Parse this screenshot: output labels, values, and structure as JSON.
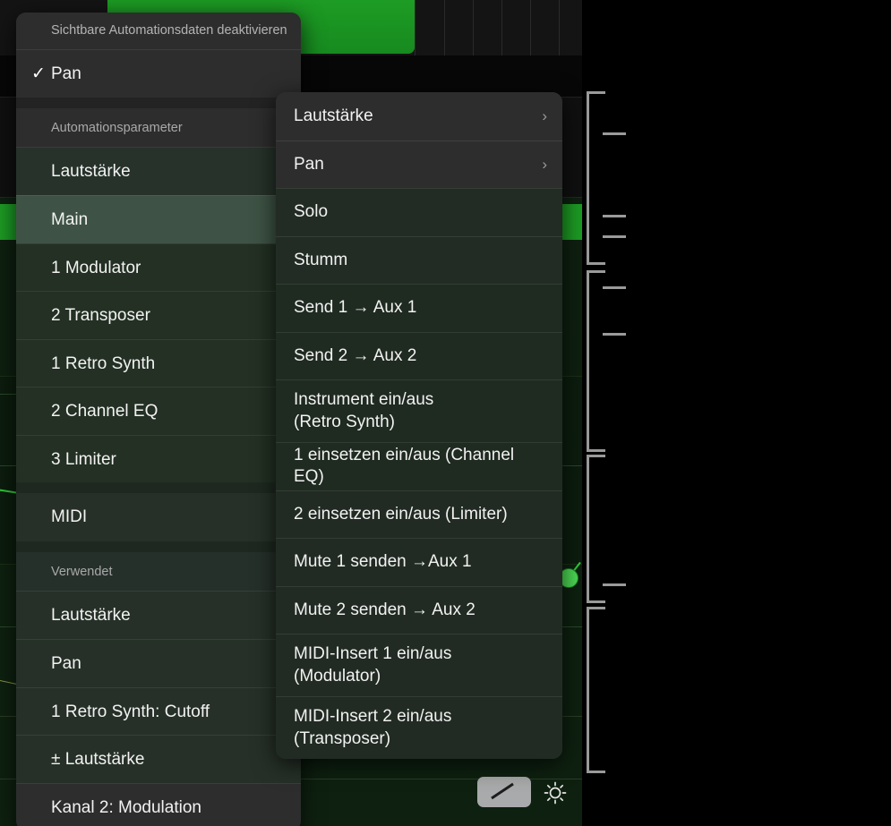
{
  "window": {
    "app_context": "Logic Pro Automationsparameter-Menü"
  },
  "background": {
    "tool_buttons": [
      {
        "name": "pencil-tool",
        "label": ""
      },
      {
        "name": "brightness-tool",
        "label": ""
      }
    ]
  },
  "menu_main": {
    "header_label": "Sichtbare Automationsdaten deaktivieren",
    "checked_item": {
      "label": "Pan",
      "check_glyph": "✓"
    },
    "section_automation_label": "Automationsparameter",
    "section_used_label": "Verwendet",
    "items_automation": [
      {
        "label": "Lautstärke",
        "selected": false
      },
      {
        "label": "Main",
        "selected": true
      },
      {
        "label": "1 Modulator",
        "selected": false
      },
      {
        "label": "2 Transposer",
        "selected": false
      },
      {
        "label": "1 Retro Synth",
        "selected": false
      },
      {
        "label": "2 Channel EQ",
        "selected": false
      },
      {
        "label": "3 Limiter",
        "selected": false
      },
      {
        "label": "MIDI",
        "selected": false
      }
    ],
    "items_used": [
      {
        "label": "Lautstärke"
      },
      {
        "label": "Pan"
      },
      {
        "label": "1 Retro Synth: Cutoff"
      },
      {
        "label": "± Lautstärke"
      },
      {
        "label": "Kanal 2: Modulation"
      }
    ]
  },
  "menu_sub": {
    "items": [
      {
        "label": "Lautstärke",
        "has_submenu": true,
        "chevron": "›",
        "lines": 1
      },
      {
        "label": "Pan",
        "has_submenu": true,
        "chevron": "›",
        "lines": 1
      },
      {
        "label": "Solo",
        "has_submenu": false,
        "chevron": "",
        "lines": 1
      },
      {
        "label": "Stumm",
        "has_submenu": false,
        "chevron": "",
        "lines": 1
      },
      {
        "label": "Send 1 → Aux 1",
        "has_submenu": false,
        "chevron": "",
        "lines": 1
      },
      {
        "label": "Send 2 → Aux 2",
        "has_submenu": false,
        "chevron": "",
        "lines": 1
      },
      {
        "label": "Instrument ein/aus\n(Retro Synth)",
        "has_submenu": false,
        "chevron": "",
        "lines": 2
      },
      {
        "label": "1 einsetzen ein/aus (Channel EQ)",
        "has_submenu": false,
        "chevron": "",
        "lines": 1
      },
      {
        "label": "2 einsetzen ein/aus (Limiter)",
        "has_submenu": false,
        "chevron": "",
        "lines": 1
      },
      {
        "label": "Mute 1 senden →Aux 1",
        "has_submenu": false,
        "chevron": "",
        "lines": 1
      },
      {
        "label": "Mute 2 senden → Aux 2",
        "has_submenu": false,
        "chevron": "",
        "lines": 1
      },
      {
        "label": "MIDI-Insert 1 ein/aus\n(Modulator)",
        "has_submenu": false,
        "chevron": "",
        "lines": 2
      },
      {
        "label": "MIDI-Insert 2 ein/aus\n(Transposer)",
        "has_submenu": false,
        "chevron": "",
        "lines": 2
      }
    ]
  },
  "colors": {
    "menu_neutral_bg": "#2d2d2d",
    "menu_tinted_bg": "#26322a",
    "menu_selected_bg": "#3e5345",
    "text_primary": "#f2f2f2",
    "text_dim": "#a9a9a9",
    "clip_green": "#1d9c24",
    "automation_green": "#4ddc55",
    "bracket_gray": "#9a9a9a"
  }
}
